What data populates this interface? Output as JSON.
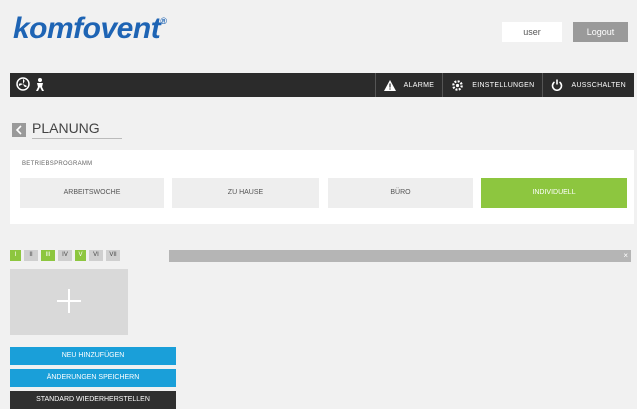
{
  "brand": {
    "name": "komfovent",
    "mark": "®"
  },
  "header": {
    "user_label": "user",
    "logout_label": "Logout"
  },
  "topbar": {
    "left_icons": [
      "fan-icon",
      "person-icon"
    ],
    "items": [
      {
        "label": "ALARME",
        "icon": "warning-icon"
      },
      {
        "label": "EINSTELLUNGEN",
        "icon": "gear-icon"
      },
      {
        "label": "AUSSCHALTEN",
        "icon": "power-icon"
      }
    ]
  },
  "page": {
    "title": "PLANUNG"
  },
  "program": {
    "label": "BETRIEBSPROGRAMM",
    "options": [
      "ARBEITSWOCHE",
      "ZU HAUSE",
      "BÜRO",
      "INDIVIDUELL"
    ],
    "selected": "INDIVIDUELL"
  },
  "days": {
    "items": [
      "I",
      "II",
      "III",
      "IV",
      "V",
      "VI",
      "VII"
    ],
    "active": [
      "I",
      "III",
      "V"
    ],
    "close": "×"
  },
  "add_box": {
    "icon": "plus-icon"
  },
  "actions": {
    "add_new": "NEU HINZUFÜGEN",
    "save": "ÄNDERUNGEN SPEICHERN",
    "restore": "STANDARD WIEDERHERSTELLEN"
  },
  "colors": {
    "brand": "#1e64b4",
    "active": "#8dc63f",
    "action": "#1a9fd9",
    "bar": "#2b2b2b"
  }
}
